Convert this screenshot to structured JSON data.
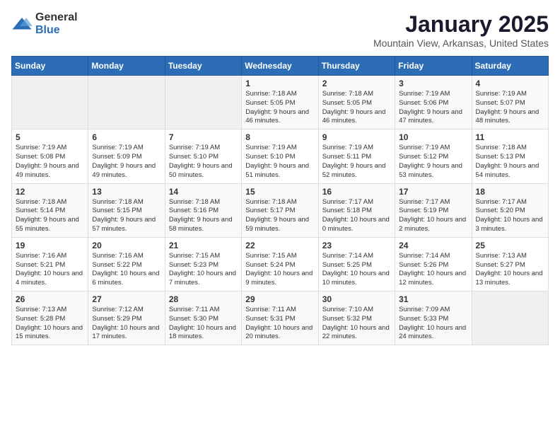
{
  "header": {
    "logo_general": "General",
    "logo_blue": "Blue",
    "title": "January 2025",
    "subtitle": "Mountain View, Arkansas, United States"
  },
  "days_of_week": [
    "Sunday",
    "Monday",
    "Tuesday",
    "Wednesday",
    "Thursday",
    "Friday",
    "Saturday"
  ],
  "weeks": [
    [
      {
        "day": "",
        "info": ""
      },
      {
        "day": "",
        "info": ""
      },
      {
        "day": "",
        "info": ""
      },
      {
        "day": "1",
        "info": "Sunrise: 7:18 AM\nSunset: 5:05 PM\nDaylight: 9 hours and 46 minutes."
      },
      {
        "day": "2",
        "info": "Sunrise: 7:18 AM\nSunset: 5:05 PM\nDaylight: 9 hours and 46 minutes."
      },
      {
        "day": "3",
        "info": "Sunrise: 7:19 AM\nSunset: 5:06 PM\nDaylight: 9 hours and 47 minutes."
      },
      {
        "day": "4",
        "info": "Sunrise: 7:19 AM\nSunset: 5:07 PM\nDaylight: 9 hours and 48 minutes."
      }
    ],
    [
      {
        "day": "5",
        "info": "Sunrise: 7:19 AM\nSunset: 5:08 PM\nDaylight: 9 hours and 49 minutes."
      },
      {
        "day": "6",
        "info": "Sunrise: 7:19 AM\nSunset: 5:09 PM\nDaylight: 9 hours and 49 minutes."
      },
      {
        "day": "7",
        "info": "Sunrise: 7:19 AM\nSunset: 5:10 PM\nDaylight: 9 hours and 50 minutes."
      },
      {
        "day": "8",
        "info": "Sunrise: 7:19 AM\nSunset: 5:10 PM\nDaylight: 9 hours and 51 minutes."
      },
      {
        "day": "9",
        "info": "Sunrise: 7:19 AM\nSunset: 5:11 PM\nDaylight: 9 hours and 52 minutes."
      },
      {
        "day": "10",
        "info": "Sunrise: 7:19 AM\nSunset: 5:12 PM\nDaylight: 9 hours and 53 minutes."
      },
      {
        "day": "11",
        "info": "Sunrise: 7:18 AM\nSunset: 5:13 PM\nDaylight: 9 hours and 54 minutes."
      }
    ],
    [
      {
        "day": "12",
        "info": "Sunrise: 7:18 AM\nSunset: 5:14 PM\nDaylight: 9 hours and 55 minutes."
      },
      {
        "day": "13",
        "info": "Sunrise: 7:18 AM\nSunset: 5:15 PM\nDaylight: 9 hours and 57 minutes."
      },
      {
        "day": "14",
        "info": "Sunrise: 7:18 AM\nSunset: 5:16 PM\nDaylight: 9 hours and 58 minutes."
      },
      {
        "day": "15",
        "info": "Sunrise: 7:18 AM\nSunset: 5:17 PM\nDaylight: 9 hours and 59 minutes."
      },
      {
        "day": "16",
        "info": "Sunrise: 7:17 AM\nSunset: 5:18 PM\nDaylight: 10 hours and 0 minutes."
      },
      {
        "day": "17",
        "info": "Sunrise: 7:17 AM\nSunset: 5:19 PM\nDaylight: 10 hours and 2 minutes."
      },
      {
        "day": "18",
        "info": "Sunrise: 7:17 AM\nSunset: 5:20 PM\nDaylight: 10 hours and 3 minutes."
      }
    ],
    [
      {
        "day": "19",
        "info": "Sunrise: 7:16 AM\nSunset: 5:21 PM\nDaylight: 10 hours and 4 minutes."
      },
      {
        "day": "20",
        "info": "Sunrise: 7:16 AM\nSunset: 5:22 PM\nDaylight: 10 hours and 6 minutes."
      },
      {
        "day": "21",
        "info": "Sunrise: 7:15 AM\nSunset: 5:23 PM\nDaylight: 10 hours and 7 minutes."
      },
      {
        "day": "22",
        "info": "Sunrise: 7:15 AM\nSunset: 5:24 PM\nDaylight: 10 hours and 9 minutes."
      },
      {
        "day": "23",
        "info": "Sunrise: 7:14 AM\nSunset: 5:25 PM\nDaylight: 10 hours and 10 minutes."
      },
      {
        "day": "24",
        "info": "Sunrise: 7:14 AM\nSunset: 5:26 PM\nDaylight: 10 hours and 12 minutes."
      },
      {
        "day": "25",
        "info": "Sunrise: 7:13 AM\nSunset: 5:27 PM\nDaylight: 10 hours and 13 minutes."
      }
    ],
    [
      {
        "day": "26",
        "info": "Sunrise: 7:13 AM\nSunset: 5:28 PM\nDaylight: 10 hours and 15 minutes."
      },
      {
        "day": "27",
        "info": "Sunrise: 7:12 AM\nSunset: 5:29 PM\nDaylight: 10 hours and 17 minutes."
      },
      {
        "day": "28",
        "info": "Sunrise: 7:11 AM\nSunset: 5:30 PM\nDaylight: 10 hours and 18 minutes."
      },
      {
        "day": "29",
        "info": "Sunrise: 7:11 AM\nSunset: 5:31 PM\nDaylight: 10 hours and 20 minutes."
      },
      {
        "day": "30",
        "info": "Sunrise: 7:10 AM\nSunset: 5:32 PM\nDaylight: 10 hours and 22 minutes."
      },
      {
        "day": "31",
        "info": "Sunrise: 7:09 AM\nSunset: 5:33 PM\nDaylight: 10 hours and 24 minutes."
      },
      {
        "day": "",
        "info": ""
      }
    ]
  ]
}
